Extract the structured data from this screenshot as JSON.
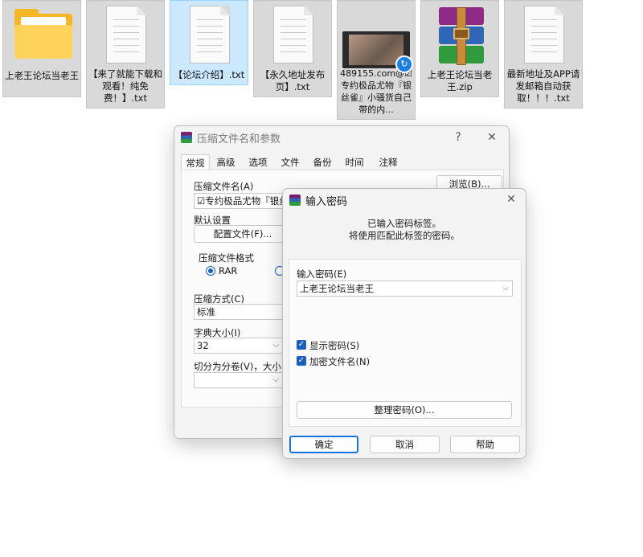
{
  "desktop": {
    "files": [
      {
        "label": "上老王论坛当老王",
        "icon": "folder-icon"
      },
      {
        "label": "【来了就能下载和观看！纯免费！】.txt",
        "icon": "text-file-icon"
      },
      {
        "label": "【论坛介绍】.txt",
        "icon": "text-file-icon"
      },
      {
        "label": "【永久地址发布页】.txt",
        "icon": "text-file-icon"
      },
      {
        "label": "489155.com@☑专约极品尤物『银丝雀』小骚货自己带的内...",
        "icon": "video-file-icon"
      },
      {
        "label": "上老王论坛当老王.zip",
        "icon": "winrar-archive-icon"
      },
      {
        "label": "最新地址及APP请发邮箱自动获取！！！.txt",
        "icon": "text-file-icon"
      }
    ]
  },
  "archive_dialog": {
    "title": "压缩文件名和参数",
    "help": "?",
    "close": "✕",
    "tabs": [
      "常规",
      "高级",
      "选项",
      "文件",
      "备份",
      "时间",
      "注释"
    ],
    "archive_name_label": "压缩文件名(A)",
    "archive_name_value": "☑专约极品尤物『银丝雀",
    "browse_button": "浏览(B)...",
    "default_settings_label": "默认设置",
    "profiles_button": "配置文件(F)...",
    "format_group": "压缩文件格式",
    "format_rar": "RAR",
    "method_label": "压缩方式(C)",
    "method_value": "标准",
    "dict_label": "字典大小(I)",
    "dict_value": "32",
    "split_label": "切分为分卷(V)，大小",
    "split_value": ""
  },
  "password_dialog": {
    "title": "输入密码",
    "close": "✕",
    "info_line1": "已输入密码标签。",
    "info_line2": "将使用匹配此标签的密码。",
    "enter_label": "输入密码(E)",
    "password_value": "上老王论坛当老王",
    "show_password": "显示密码(S)",
    "encrypt_names": "加密文件名(N)",
    "organize_button": "整理密码(O)...",
    "ok": "确定",
    "cancel": "取消",
    "help": "帮助"
  },
  "colors": {
    "accent": "#1a73d9",
    "check": "#1a5fc0",
    "selected_tile": "#cce8ff"
  }
}
